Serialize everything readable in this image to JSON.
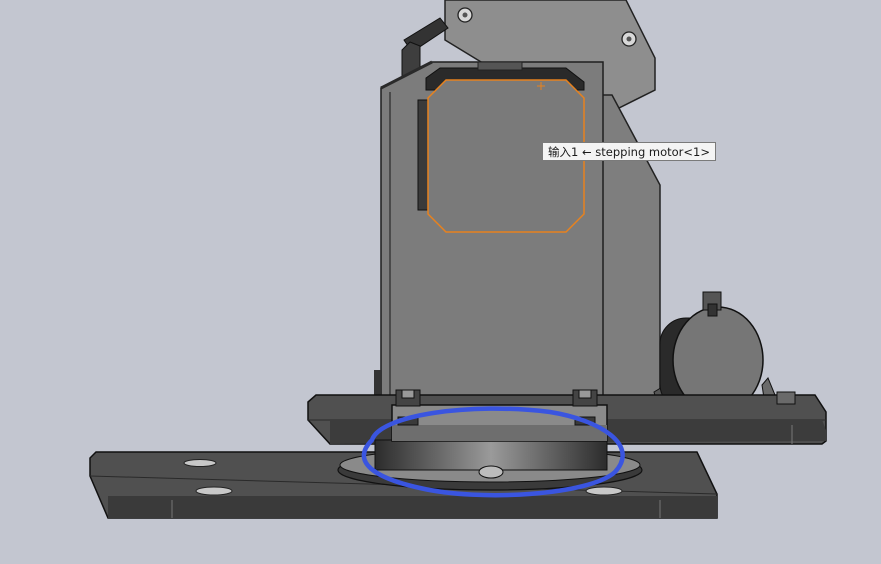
{
  "viewport": {
    "background_color": "#c3c6d0",
    "selection_color": "#e8821e",
    "annotation_color": "#3a55e0"
  },
  "tooltip": {
    "mate_label": "输入1",
    "arrow": "←",
    "component": "stepping motor<1>"
  },
  "icons": [
    "pivot-screw-icon",
    "origin-marker-icon"
  ]
}
